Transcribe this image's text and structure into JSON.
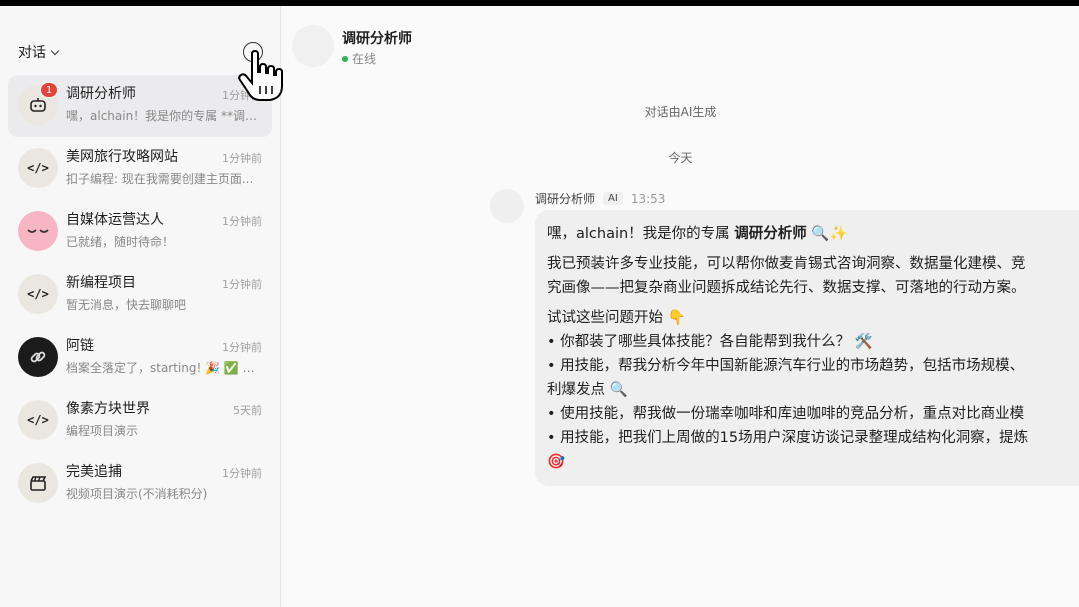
{
  "sidebar": {
    "header_label": "对话",
    "conversations": [
      {
        "title": "调研分析师",
        "time": "1分钟前",
        "preview": "嘿，alchain！我是你的专属 **调研分析师**",
        "badge": "1",
        "avatar": "robot"
      },
      {
        "title": "美网旅行攻略网站",
        "time": "1分钟前",
        "preview": "扣子编程: 现在我需要创建主页面...",
        "avatar": "code"
      },
      {
        "title": "自媒体运营达人",
        "time": "1分钟前",
        "preview": "已就绪，随时待命！",
        "avatar": "face"
      },
      {
        "title": "新编程项目",
        "time": "1分钟前",
        "preview": "暂无消息，快去聊聊吧",
        "avatar": "code"
      },
      {
        "title": "阿链",
        "time": "1分钟前",
        "preview": "档案全落定了，starting! 🎉 ✅ 代号...",
        "avatar": "link"
      },
      {
        "title": "像素方块世界",
        "time": "5天前",
        "preview": "编程项目演示",
        "avatar": "code"
      },
      {
        "title": "完美追捕",
        "time": "1分钟前",
        "preview": "视频项目演示(不消耗积分)",
        "avatar": "clapper"
      }
    ]
  },
  "chat": {
    "title": "调研分析师",
    "status": "在线",
    "system_note": "对话由AI生成",
    "date_divider": "今天",
    "message": {
      "sender": "调研分析师",
      "tag": "AI",
      "time": "13:53",
      "line1_pre": "嘿，alchain！我是你的专属 ",
      "line1_strong": "调研分析师",
      "line1_post": " 🔍✨",
      "line2": "我已预装许多专业技能，可以帮你做麦肯锡式咨询洞察、数据量化建模、竞",
      "line3": "究画像——把复杂商业问题拆成结论先行、数据支撑、可落地的行动方案。",
      "line4": "试试这些问题开始 👇",
      "line5": "• 你都装了哪些具体技能？各自能帮到我什么？ 🛠️",
      "line6": "• 用技能，帮我分析今年中国新能源汽车行业的市场趋势，包括市场规模、",
      "line7": "利爆发点 🔍",
      "line8": "• 使用技能，帮我做一份瑞幸咖啡和库迪咖啡的竞品分析，重点对比商业模",
      "line9": "• 用技能，把我们上周做的15场用户深度访谈记录整理成结构化洞察，提炼",
      "line10": "🎯"
    }
  },
  "icons": {
    "code": "</>",
    "new": "new-chat-icon"
  },
  "colors": {
    "badge": "#e6423a",
    "online": "#2fb35a",
    "active_item": "#ebebed"
  }
}
